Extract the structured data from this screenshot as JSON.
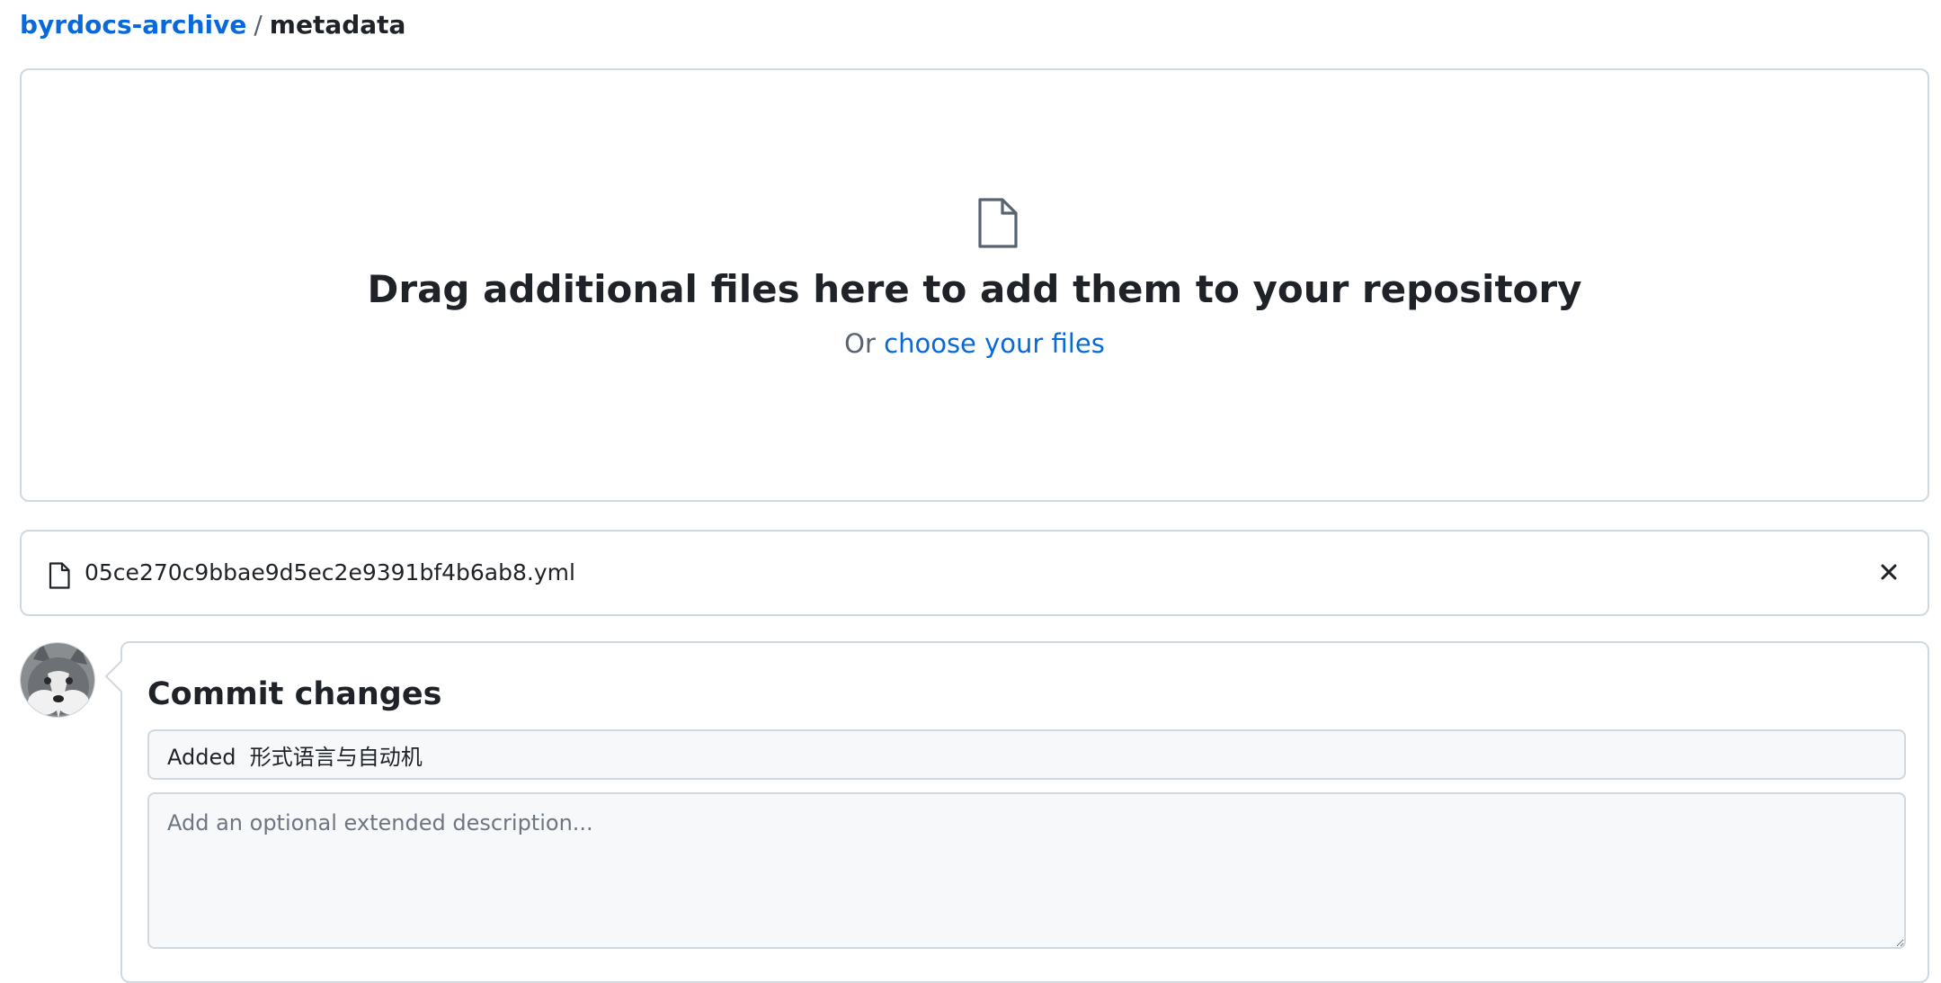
{
  "breadcrumb": {
    "repo": "byrdocs-archive",
    "separator": "/",
    "directory": "metadata"
  },
  "dropzone": {
    "icon": "file-icon",
    "title": "Drag additional files here to add them to your repository",
    "prefix": "Or",
    "choose_link": "choose your files"
  },
  "uploaded_files": [
    {
      "name": "05ce270c9bbae9d5ec2e9391bf4b6ab8.yml",
      "icon": "file-icon",
      "remove_icon": "close-icon"
    }
  ],
  "commit": {
    "title": "Commit changes",
    "summary_value": "Added  形式语言与自动机",
    "description_placeholder": "Add an optional extended description..."
  },
  "colors": {
    "link": "#0969da",
    "border": "#d1d9e0",
    "text": "#1f2328",
    "muted": "#59636e",
    "input_bg": "#f6f8fa"
  }
}
